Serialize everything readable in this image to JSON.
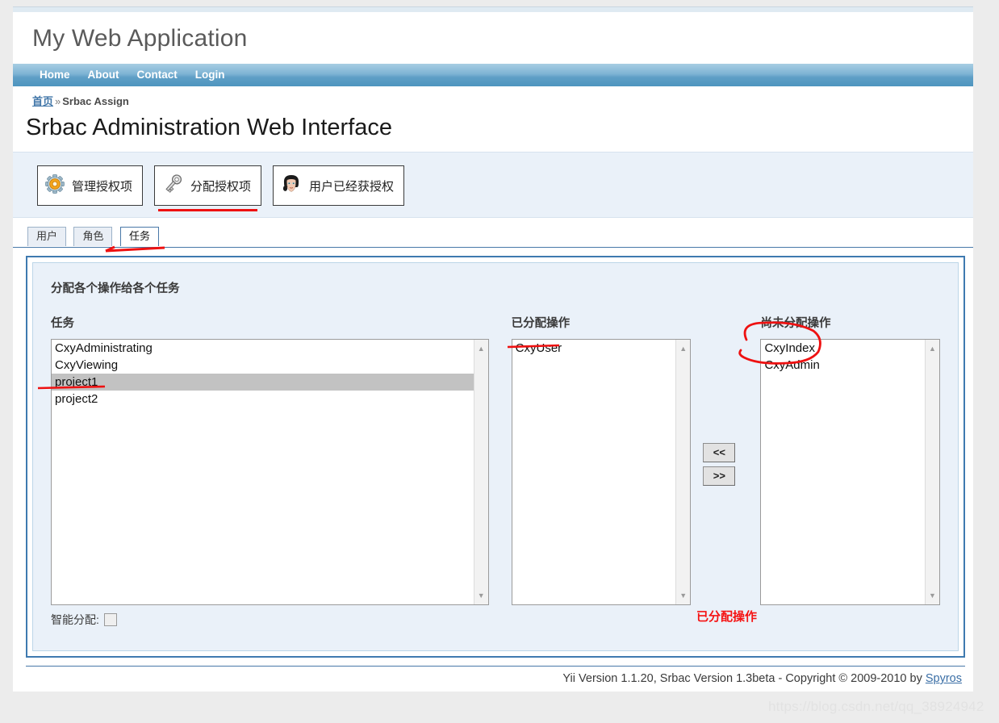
{
  "header": {
    "logo": "My Web Application"
  },
  "mainmenu": {
    "items": [
      {
        "label": "Home"
      },
      {
        "label": "About"
      },
      {
        "label": "Contact"
      },
      {
        "label": "Login"
      }
    ]
  },
  "breadcrumb": {
    "home": "首页",
    "separator": "»",
    "current": "Srbac Assign"
  },
  "page_title": "Srbac Administration Web Interface",
  "toolbar": {
    "buttons": [
      {
        "label": "管理授权项",
        "icon": "gear-icon",
        "active": false
      },
      {
        "label": "分配授权项",
        "icon": "key-icon",
        "active": true
      },
      {
        "label": "用户已经获授权",
        "icon": "face-avatar-icon",
        "active": false
      }
    ]
  },
  "tabs": [
    {
      "label": "用户",
      "active": false
    },
    {
      "label": "角色",
      "active": false
    },
    {
      "label": "任务",
      "active": true
    }
  ],
  "panel": {
    "title": "分配各个操作给各个任务",
    "task_column": {
      "label": "任务",
      "options": [
        {
          "text": "CxyAdministrating",
          "selected": false
        },
        {
          "text": "CxyViewing",
          "selected": false
        },
        {
          "text": "project1",
          "selected": true
        },
        {
          "text": "project2",
          "selected": false
        }
      ]
    },
    "assigned_column": {
      "label": "已分配操作",
      "options": [
        {
          "text": "CxyUser",
          "selected": false
        }
      ]
    },
    "unassigned_column": {
      "label": "尚未分配操作",
      "options": [
        {
          "text": "CxyIndex",
          "selected": false
        },
        {
          "text": "CxyAdmin",
          "selected": false
        }
      ]
    },
    "transfer": {
      "move_left_label": "<<",
      "move_right_label": ">>"
    },
    "smart_assign": {
      "label": "智能分配:",
      "checked": false
    },
    "red_note": "已分配操作"
  },
  "footer": {
    "text": "Yii Version 1.1.20,  Srbac Version 1.3beta - Copyright © 2009-2010 by ",
    "link": "Spyros"
  },
  "watermark": "https://blog.csdn.net/qq_38924942",
  "colors": {
    "menu_blue": "#4e95bf",
    "panel_border": "#3f7ab0",
    "panel_bg": "#eaf1f9",
    "annotation_red": "#ee1111",
    "selected_option": "#c2c2c2",
    "link_blue": "#3a6ea5"
  },
  "scrollbar": {
    "up_glyph": "▲",
    "down_glyph": "▼"
  }
}
